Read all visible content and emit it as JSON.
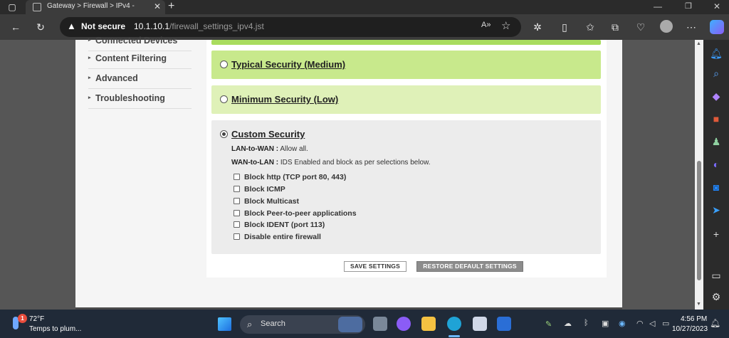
{
  "browser": {
    "tab_title": "Gateway > Firewall > IPv4 -",
    "new_tab_symbol": "+",
    "not_secure_label": "Not secure",
    "url_host": "10.1.10.1",
    "url_path": "/firewall_settings_ipv4.jst"
  },
  "sidebar": {
    "items": [
      {
        "label": "Connected Devices"
      },
      {
        "label": "Content Filtering"
      },
      {
        "label": "Advanced"
      },
      {
        "label": "Troubleshooting"
      }
    ]
  },
  "security": {
    "typical_label": "Typical Security (Medium)",
    "minimum_label": "Minimum Security (Low)",
    "custom_label": "Custom Security",
    "selected": "custom",
    "lan_to_wan_key": "LAN-to-WAN :",
    "lan_to_wan_value": "Allow all.",
    "wan_to_lan_key": "WAN-to-LAN :",
    "wan_to_lan_value": "IDS Enabled and block as per selections below.",
    "options": [
      {
        "label": "Block http (TCP port 80, 443)",
        "checked": false
      },
      {
        "label": "Block ICMP",
        "checked": false
      },
      {
        "label": "Block Multicast",
        "checked": false
      },
      {
        "label": "Block Peer-to-peer applications",
        "checked": false
      },
      {
        "label": "Block IDENT (port 113)",
        "checked": false
      },
      {
        "label": "Disable entire firewall",
        "checked": false
      }
    ]
  },
  "buttons": {
    "save": "SAVE SETTINGS",
    "restore": "RESTORE DEFAULT SETTINGS"
  },
  "taskbar": {
    "weather_temp": "72°F",
    "weather_desc": "Temps to plum...",
    "weather_badge": "1",
    "search_label": "Search",
    "time": "4:56 PM",
    "date": "10/27/2023"
  },
  "colors": {
    "green_strong": "#c8e98c",
    "green_light": "#dff1b8",
    "custom_bg": "#ececec"
  }
}
